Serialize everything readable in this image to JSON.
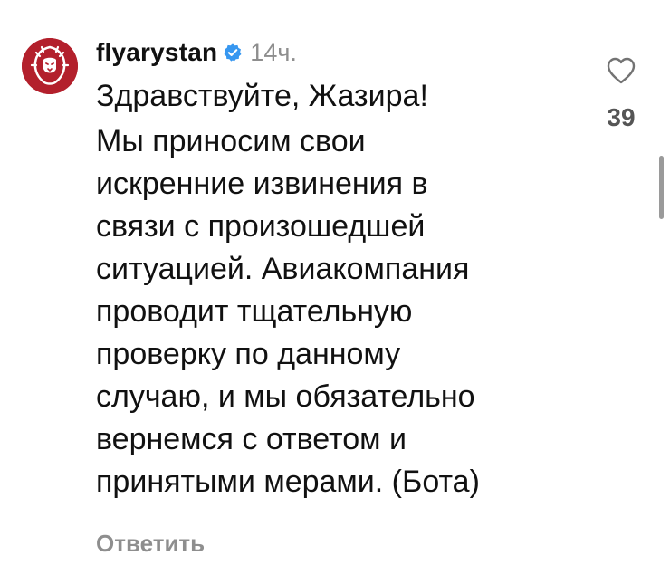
{
  "comment": {
    "avatar_icon": "lion-logo-icon",
    "brand_color": "#b3202c",
    "username": "flyarystan",
    "verified_icon": "verified-badge-icon",
    "verified_color": "#3797f0",
    "timestamp": "14ч.",
    "greeting": "Здравствуйте, Жазира!",
    "message": "Мы приносим свои\nискренние извинения в\nсвязи с произошедшей\nситуацией. Авиакомпания\nпроводит тщательную\nпроверку по данному\nслучаю, и мы обязательно\nвернемся с ответом и\nпринятыми мерами. (Бота)",
    "reply_label": "Ответить",
    "like_icon": "heart-icon",
    "like_count": "39"
  }
}
